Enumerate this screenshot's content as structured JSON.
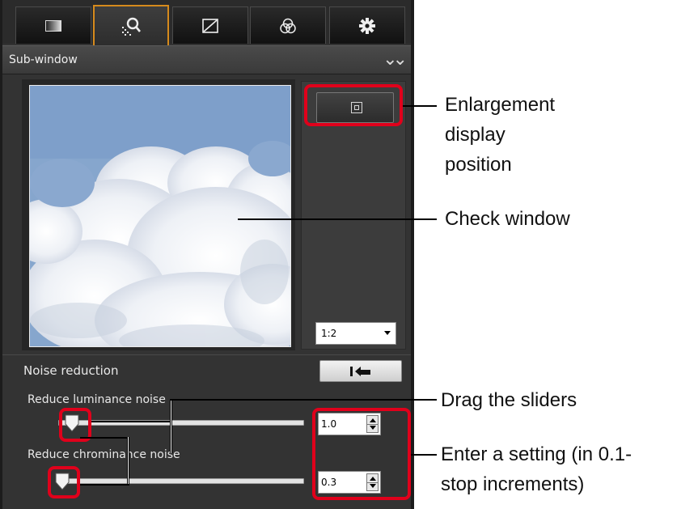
{
  "panel": {
    "tabs": [
      {
        "icon": "basic-image-adjustment-icon",
        "active": false
      },
      {
        "icon": "noise-detail-icon",
        "active": true
      },
      {
        "icon": "tone-curve-icon",
        "active": false
      },
      {
        "icon": "color-adjustment-icon",
        "active": false
      },
      {
        "icon": "settings-gear-icon",
        "active": false
      }
    ],
    "subwindow_label": "Sub-window",
    "collapse_icon": "double-chevron-down-icon",
    "zoom_value": "1:2",
    "noise_reduction_label": "Noise reduction",
    "reset_icon": "reset-arrow-icon",
    "luminance": {
      "label": "Reduce luminance noise",
      "value": "1.0",
      "level": 0.05
    },
    "chrominance": {
      "label": "Reduce chrominance noise",
      "value": "0.3",
      "level": 0.02
    }
  },
  "annotations": {
    "enlargement_line1": "Enlargement",
    "enlargement_line2": "display",
    "enlargement_line3": "position",
    "check_window": "Check window",
    "drag_sliders": "Drag the sliders",
    "enter_setting_line1": "Enter a setting (in 0.1-",
    "enter_setting_line2": "stop increments)"
  },
  "colors": {
    "highlight": "#e0001b",
    "active_tab_border": "#d68a1c",
    "panel_bg": "#333333"
  }
}
